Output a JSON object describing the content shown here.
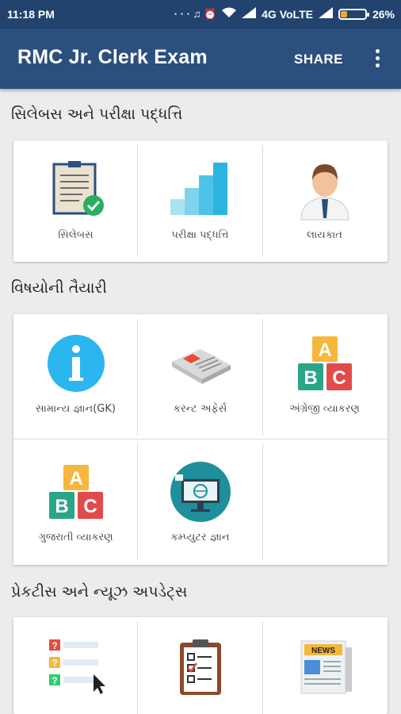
{
  "status_bar": {
    "time": "11:18 PM",
    "network": "4G VoLTE",
    "battery": "26%",
    "battery_level": 0.26
  },
  "app_bar": {
    "title": "RMC Jr. Clerk Exam",
    "share_label": "SHARE",
    "more_icon": "more-vert-icon"
  },
  "sections": [
    {
      "title": "સિલેબસ અને પરીક્ષા પદ્ધત્તિ",
      "items": [
        {
          "label": "સિલેબસ",
          "icon": "syllabus-icon"
        },
        {
          "label": "પરીક્ષા પદ્ધત્તિ",
          "icon": "bar-steps-icon"
        },
        {
          "label": "લાયકાત",
          "icon": "person-icon"
        }
      ]
    },
    {
      "title": "વિષયોની  તૈયારી",
      "items": [
        {
          "label": "સામાન્ય જ્ઞાન(GK)",
          "icon": "info-icon"
        },
        {
          "label": "કરન્ટ અફેર્સ",
          "icon": "newspaper-icon"
        },
        {
          "label": "અંગ્રેજી વ્યાકરણ",
          "icon": "abc-blocks-icon"
        },
        {
          "label": "ગુજરાતી વ્યાકરણ",
          "icon": "abc-blocks-icon"
        },
        {
          "label": "કમ્પ્યુટર જ્ઞાન",
          "icon": "computer-icon"
        }
      ]
    },
    {
      "title": "પ્રેકટીસ અને ન્યૂઝ અપડેટ્સ",
      "items": [
        {
          "label": "",
          "icon": "quiz-list-icon"
        },
        {
          "label": "",
          "icon": "clipboard-checklist-icon"
        },
        {
          "label": "NEWS",
          "icon": "news-icon"
        }
      ]
    }
  ]
}
